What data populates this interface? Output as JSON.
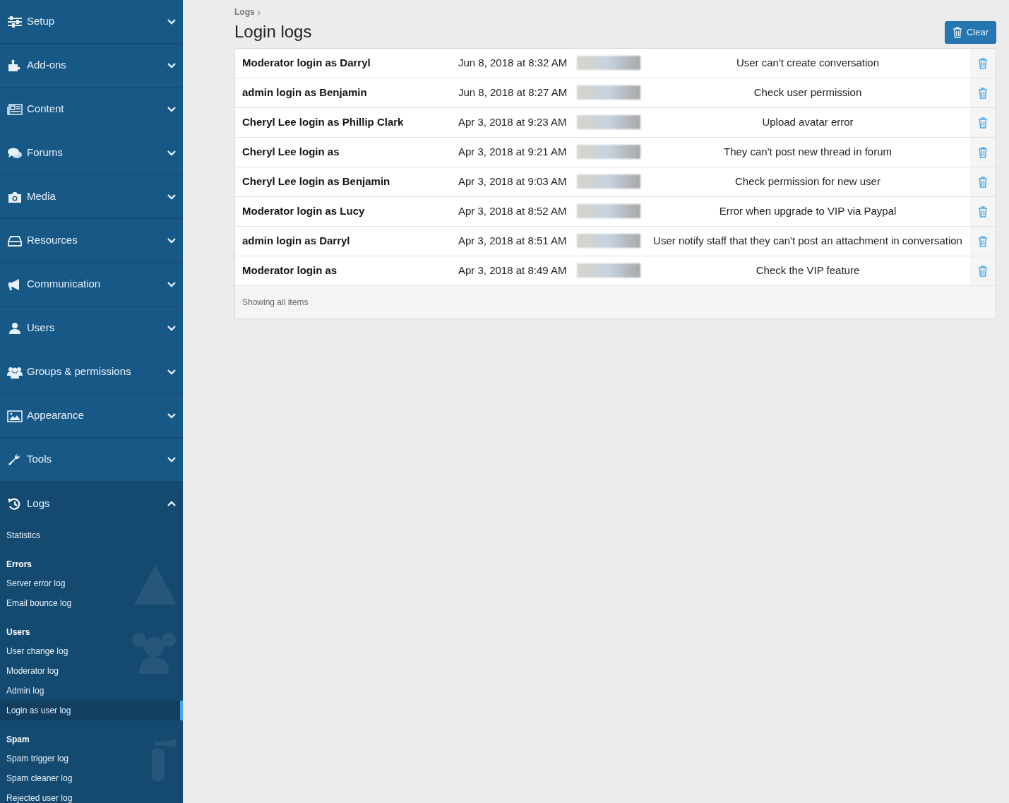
{
  "sidebar": {
    "sections": [
      {
        "label": "Setup",
        "expanded": false
      },
      {
        "label": "Add-ons",
        "expanded": false
      },
      {
        "label": "Content",
        "expanded": false
      },
      {
        "label": "Forums",
        "expanded": false
      },
      {
        "label": "Media",
        "expanded": false
      },
      {
        "label": "Resources",
        "expanded": false
      },
      {
        "label": "Communication",
        "expanded": false
      },
      {
        "label": "Users",
        "expanded": false
      },
      {
        "label": "Groups & permissions",
        "expanded": false
      },
      {
        "label": "Appearance",
        "expanded": false
      },
      {
        "label": "Tools",
        "expanded": false
      },
      {
        "label": "Logs",
        "expanded": true,
        "items": [
          {
            "kind": "link",
            "label": "Statistics",
            "selected": false
          },
          {
            "kind": "group",
            "label": "Errors",
            "children": [
              {
                "label": "Server error log",
                "selected": false
              },
              {
                "label": "Email bounce log",
                "selected": false
              }
            ]
          },
          {
            "kind": "group",
            "label": "Users",
            "children": [
              {
                "label": "User change log",
                "selected": false
              },
              {
                "label": "Moderator log",
                "selected": false
              },
              {
                "label": "Admin log",
                "selected": false
              },
              {
                "label": "Login as user log",
                "selected": true
              }
            ]
          },
          {
            "kind": "group",
            "label": "Spam",
            "children": [
              {
                "label": "Spam trigger log",
                "selected": false
              },
              {
                "label": "Spam cleaner log",
                "selected": false
              },
              {
                "label": "Rejected user log",
                "selected": false
              }
            ]
          }
        ]
      }
    ]
  },
  "breadcrumb": [
    "Logs"
  ],
  "title": "Login logs",
  "clear_button": "Clear",
  "table": {
    "rows": [
      {
        "name": "Moderator login as Darryl",
        "date": "Jun 8, 2018 at 8:32 AM",
        "note": "User can't create conversation"
      },
      {
        "name": "admin login as Benjamin",
        "date": "Jun 8, 2018 at 8:27 AM",
        "note": "Check user permission"
      },
      {
        "name": "Cheryl Lee login as Phillip Clark",
        "date": "Apr 3, 2018 at 9:23 AM",
        "note": "Upload avatar error"
      },
      {
        "name": "Cheryl Lee login as",
        "date": "Apr 3, 2018 at 9:21 AM",
        "note": "They can't post new thread in forum"
      },
      {
        "name": "Cheryl Lee login as Benjamin",
        "date": "Apr 3, 2018 at 9:03 AM",
        "note": "Check permission for new user"
      },
      {
        "name": "Moderator login as Lucy",
        "date": "Apr 3, 2018 at 8:52 AM",
        "note": "Error when upgrade to VIP via Paypal"
      },
      {
        "name": "admin login as Darryl",
        "date": "Apr 3, 2018 at 8:51 AM",
        "note": "User notify staff that they can't post an attachment in conversation"
      },
      {
        "name": "Moderator login as",
        "date": "Apr 3, 2018 at 8:49 AM",
        "note": "Check the VIP feature"
      }
    ],
    "footer": "Showing all items"
  }
}
